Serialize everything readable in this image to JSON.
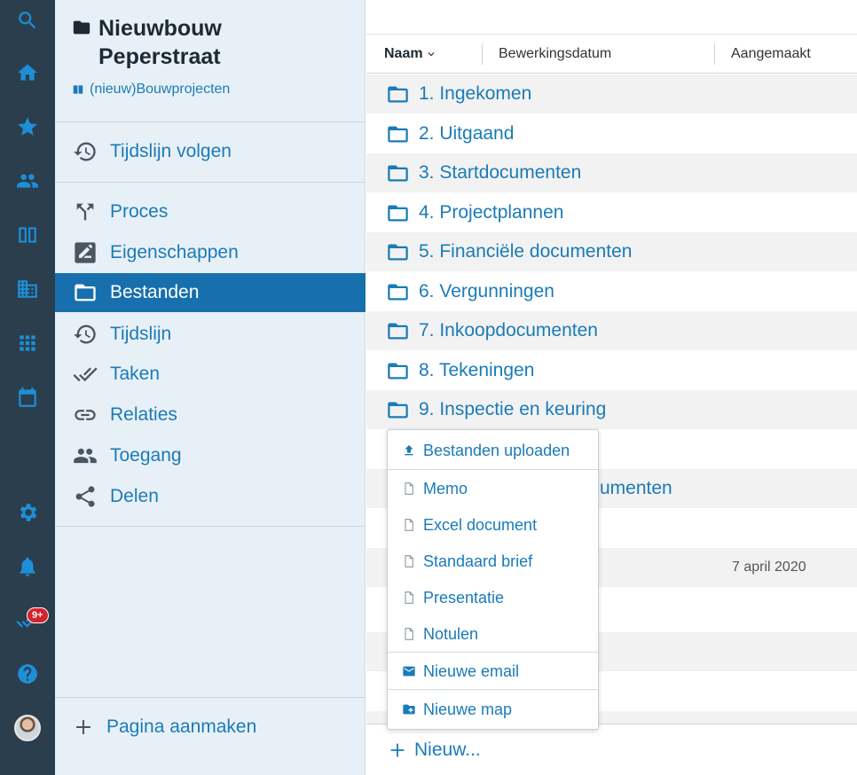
{
  "rail": {
    "items": [
      "search-icon",
      "home-icon",
      "star-icon",
      "people-icon",
      "book-icon",
      "building-icon",
      "grid-icon",
      "calendar-icon",
      "gear-icon",
      "bell-icon",
      "tasks-icon",
      "help-icon",
      "avatar"
    ],
    "tasks_badge": "9+"
  },
  "sidebar": {
    "title": "Nieuwbouw Peperstraat",
    "breadcrumb": "(nieuw)Bouwprojecten",
    "follow": "Tijdslijn volgen",
    "items": [
      {
        "label": "Proces",
        "icon": "process-icon"
      },
      {
        "label": "Eigenschappen",
        "icon": "edit-box-icon"
      },
      {
        "label": "Bestanden",
        "icon": "folder-icon"
      },
      {
        "label": "Tijdslijn",
        "icon": "history-icon"
      },
      {
        "label": "Taken",
        "icon": "double-check-icon"
      },
      {
        "label": "Relaties",
        "icon": "link-icon"
      },
      {
        "label": "Toegang",
        "icon": "people-icon"
      },
      {
        "label": "Delen",
        "icon": "share-icon"
      }
    ],
    "active": "Bestanden",
    "create_page": "Pagina aanmaken"
  },
  "table": {
    "columns": {
      "name": "Naam",
      "modified": "Bewerkingsdatum",
      "created": "Aangemaakt"
    },
    "rows": [
      {
        "name": "1. Ingekomen"
      },
      {
        "name": "2. Uitgaand"
      },
      {
        "name": "3. Startdocumenten"
      },
      {
        "name": "4. Projectplannen"
      },
      {
        "name": "5. Financiële documenten"
      },
      {
        "name": "6. Vergunningen"
      },
      {
        "name": "7. Inkoopdocumenten"
      },
      {
        "name": "8. Tekeningen"
      },
      {
        "name": "9. Inspectie en keuring"
      }
    ],
    "partial_row_text": "umenten",
    "partial_date": "7 april 2020",
    "new_label": "Nieuw..."
  },
  "menu": {
    "upload": "Bestanden uploaden",
    "docs": [
      "Memo",
      "Excel document",
      "Standaard brief",
      "Presentatie",
      "Notulen"
    ],
    "email": "Nieuwe email",
    "folder": "Nieuwe map"
  },
  "colors": {
    "rail": "#2a3e4e",
    "sidebar": "#e8f0f7",
    "active": "#1770ad",
    "link": "#1a7bb8",
    "badge": "#d6202a"
  }
}
